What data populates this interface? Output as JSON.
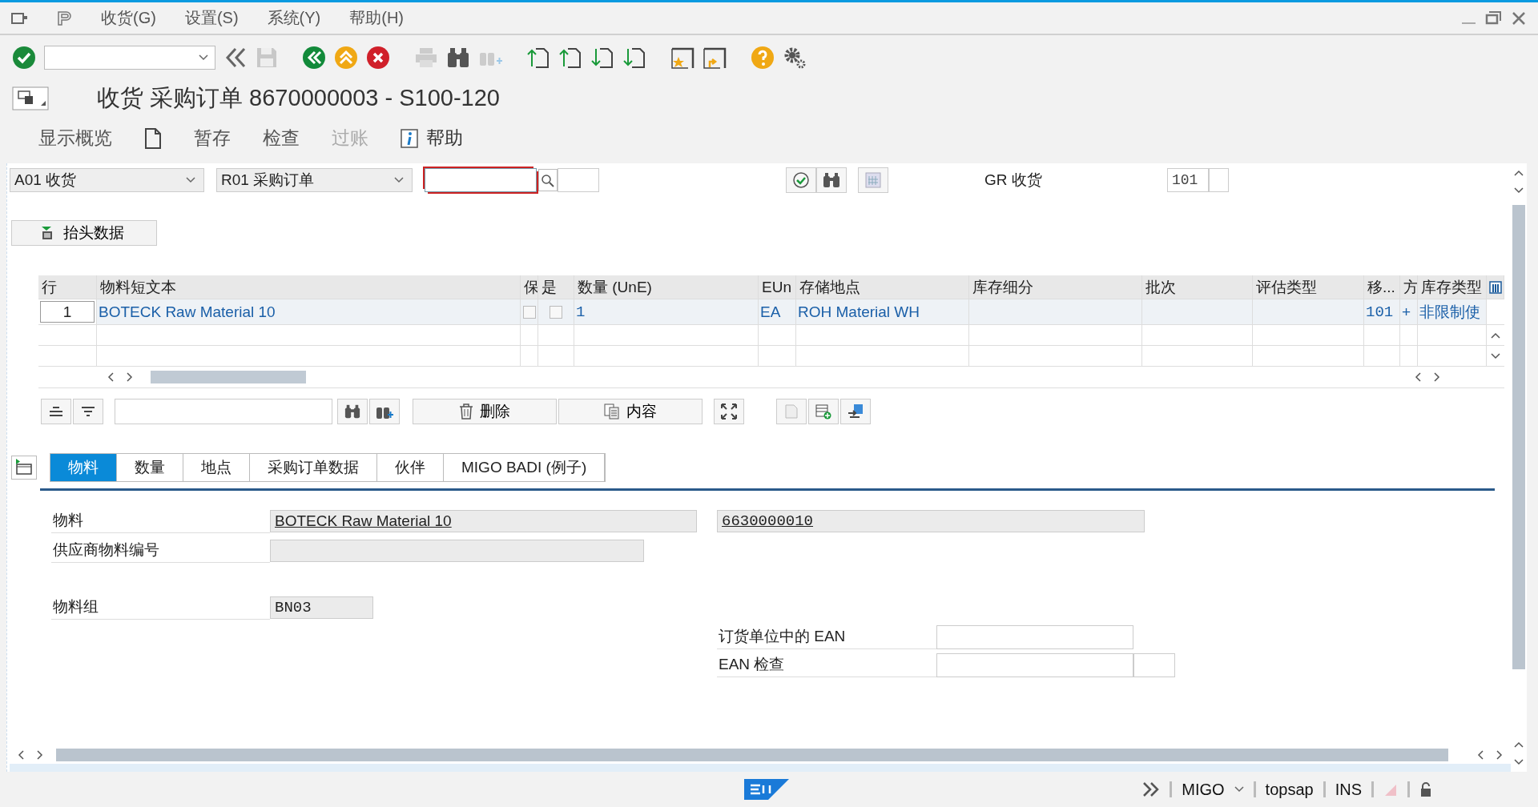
{
  "menu_bar": {
    "items": [
      "收货(G)",
      "设置(S)",
      "系统(Y)",
      "帮助(H)"
    ]
  },
  "title": "收货 采购订单 8670000003 - S100-120",
  "app_toolbar": [
    {
      "kind": "text",
      "label": "显示概览",
      "disabled": false
    },
    {
      "kind": "icon",
      "disabled": false
    },
    {
      "kind": "text",
      "label": "暂存",
      "disabled": false
    },
    {
      "kind": "text",
      "label": "检查",
      "disabled": false
    },
    {
      "kind": "text",
      "label": "过账",
      "disabled": true
    },
    {
      "kind": "info",
      "label": "帮助",
      "disabled": false
    }
  ],
  "selection": {
    "action": "A01 收货",
    "reference": "R01 采购订单",
    "movement_label": "GR 收货",
    "movement_type": "101"
  },
  "header_button": "抬头数据",
  "items_table": {
    "columns": [
      "行",
      "物料短文本",
      "保",
      "是",
      "数量 (UnE)",
      "EUn",
      "存储地点",
      "库存细分",
      "批次",
      "评估类型",
      "移...",
      "方",
      "库存类型"
    ],
    "rows": [
      {
        "cells": [
          {
            "kind": "line",
            "text": "1"
          },
          {
            "kind": "text",
            "text": "BOTECK Raw Material 10"
          },
          {
            "kind": "check",
            "checked": false
          },
          {
            "kind": "check",
            "checked": false
          },
          {
            "kind": "mono",
            "text": "1"
          },
          {
            "kind": "text",
            "text": "EA"
          },
          {
            "kind": "text",
            "text": "ROH Material WH"
          },
          {
            "kind": "empty"
          },
          {
            "kind": "empty"
          },
          {
            "kind": "empty"
          },
          {
            "kind": "mono",
            "text": "101"
          },
          {
            "kind": "text",
            "text": "+"
          },
          {
            "kind": "text",
            "text": "非限制使"
          }
        ]
      }
    ]
  },
  "table_toolbar": {
    "buttons": [
      "删除",
      "内容"
    ]
  },
  "tabs": [
    {
      "label": "物料",
      "selected": true
    },
    {
      "label": "数量",
      "selected": false
    },
    {
      "label": "地点",
      "selected": false
    },
    {
      "label": "采购订单数据",
      "selected": false
    },
    {
      "label": "伙伴",
      "selected": false
    },
    {
      "label": "MIGO BADI (例子)",
      "selected": false
    }
  ],
  "material_tab": {
    "material_label": "物料",
    "material": "BOTECK Raw Material 10",
    "material_number": "6630000010",
    "vendor_material_label": "供应商物料编号",
    "material_group_label": "物料组",
    "material_group": "BN03",
    "ean_fields": [
      {
        "label": "订货单位中的  EAN"
      },
      {
        "label": "EAN 检查"
      }
    ]
  },
  "status_bar": {
    "transaction": "MIGO",
    "user": "topsap",
    "mode": "INS"
  }
}
